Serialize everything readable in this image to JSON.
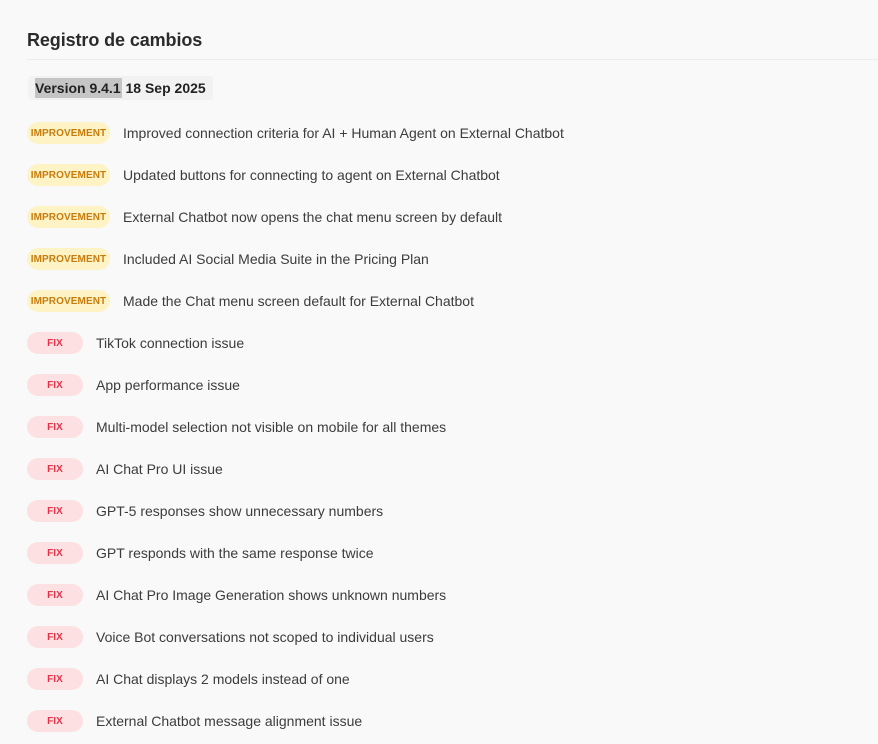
{
  "changelog": {
    "title": "Registro de cambios",
    "version_label": "Version 9.4.1",
    "version_date": "18 Sep 2025",
    "entries": [
      {
        "type": "improvement",
        "badge": "IMPROVEMENT",
        "text": "Improved connection criteria for AI + Human Agent on External Chatbot"
      },
      {
        "type": "improvement",
        "badge": "IMPROVEMENT",
        "text": "Updated buttons for connecting to agent on External Chatbot"
      },
      {
        "type": "improvement",
        "badge": "IMPROVEMENT",
        "text": "External Chatbot now opens the chat menu screen by default"
      },
      {
        "type": "improvement",
        "badge": "IMPROVEMENT",
        "text": "Included AI Social Media Suite in the Pricing Plan"
      },
      {
        "type": "improvement",
        "badge": "IMPROVEMENT",
        "text": "Made the Chat menu screen default for External Chatbot"
      },
      {
        "type": "fix",
        "badge": "FIX",
        "text": "TikTok connection issue"
      },
      {
        "type": "fix",
        "badge": "FIX",
        "text": "App performance issue"
      },
      {
        "type": "fix",
        "badge": "FIX",
        "text": "Multi-model selection not visible on mobile for all themes"
      },
      {
        "type": "fix",
        "badge": "FIX",
        "text": "AI Chat Pro UI issue"
      },
      {
        "type": "fix",
        "badge": "FIX",
        "text": "GPT-5 responses show unnecessary numbers"
      },
      {
        "type": "fix",
        "badge": "FIX",
        "text": "GPT responds with the same response twice"
      },
      {
        "type": "fix",
        "badge": "FIX",
        "text": "AI Chat Pro Image Generation shows unknown numbers"
      },
      {
        "type": "fix",
        "badge": "FIX",
        "text": "Voice Bot conversations not scoped to individual users"
      },
      {
        "type": "fix",
        "badge": "FIX",
        "text": "AI Chat displays 2 models instead of one"
      },
      {
        "type": "fix",
        "badge": "FIX",
        "text": "External Chatbot message alignment issue"
      }
    ]
  },
  "colors": {
    "improvement_badge_bg": "#fdf3c4",
    "improvement_badge_text": "#c87c0c",
    "fix_badge_bg": "#fde0e2",
    "fix_badge_text": "#e0344a",
    "selection_highlight": "#c5c5c5"
  }
}
